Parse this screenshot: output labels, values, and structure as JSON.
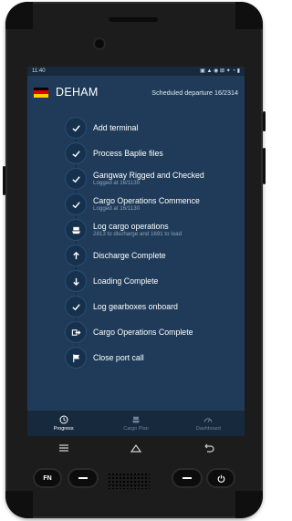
{
  "statusbar": {
    "time": "11:40",
    "icons": "▣ ▲ ◉ ⊠ ✦ ◔ ▮"
  },
  "header": {
    "port": "DEHAM",
    "departure": "Scheduled departure 16/2314",
    "flag_colors": [
      "#000000",
      "#dd0000",
      "#ffce00"
    ]
  },
  "steps": [
    {
      "icon": "check-icon",
      "title": "Add terminal",
      "subtitle": ""
    },
    {
      "icon": "check-icon",
      "title": "Process Baplie files",
      "subtitle": ""
    },
    {
      "icon": "check-icon",
      "title": "Gangway Rigged and Checked",
      "subtitle": "Logged at 16/1130"
    },
    {
      "icon": "check-icon",
      "title": "Cargo Operations Commence",
      "subtitle": "Logged at 16/1130"
    },
    {
      "icon": "ship-icon",
      "title": "Log cargo operations",
      "subtitle": "2813 to discharge and 1691 to load"
    },
    {
      "icon": "arrow-up-icon",
      "title": "Discharge Complete",
      "subtitle": ""
    },
    {
      "icon": "arrow-down-icon",
      "title": "Loading Complete",
      "subtitle": ""
    },
    {
      "icon": "check-icon",
      "title": "Log gearboxes onboard",
      "subtitle": ""
    },
    {
      "icon": "exit-icon",
      "title": "Cargo Operations Complete",
      "subtitle": ""
    },
    {
      "icon": "flag-icon",
      "title": "Close port call",
      "subtitle": ""
    }
  ],
  "tabs": [
    {
      "label": "Progress",
      "icon": "clock-icon",
      "active": true
    },
    {
      "label": "Cargo Plan",
      "icon": "ship-icon",
      "active": false
    },
    {
      "label": "Dashboard",
      "icon": "gauge-icon",
      "active": false
    }
  ],
  "hardware": {
    "fn_label": "FN"
  },
  "colors": {
    "screen_bg": "#1f3b59",
    "icon_bg": "#16314e",
    "tabbar_bg": "#16293d"
  }
}
